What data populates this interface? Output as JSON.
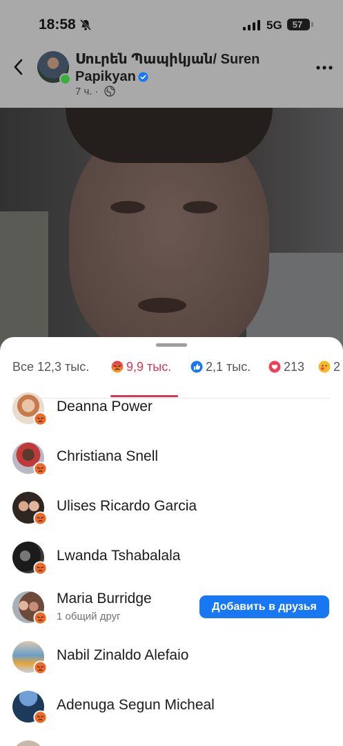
{
  "status_bar": {
    "time": "18:58",
    "network": "5G",
    "battery": "57"
  },
  "post": {
    "author": "Սուրեն Պապիկյան/ Suren Papikyan",
    "time_ago": "7 ч.",
    "separator": "·"
  },
  "reactions": {
    "tabs": [
      {
        "label": "Все 12,3 тыс.",
        "icon": null
      },
      {
        "label": "9,9 тыс.",
        "icon": "angry-icon",
        "active": true
      },
      {
        "label": "2,1 тыс.",
        "icon": "like-icon"
      },
      {
        "label": "213",
        "icon": "love-icon"
      },
      {
        "label": "2",
        "icon": "care-icon"
      }
    ],
    "people": [
      {
        "name": "Deanna Power"
      },
      {
        "name": "Christiana Snell"
      },
      {
        "name": "Ulises Ricardo Garcia"
      },
      {
        "name": "Lwanda Tshabalala"
      },
      {
        "name": "Maria Burridge",
        "subtitle": "1 общий друг",
        "button": "Добавить в друзья"
      },
      {
        "name": "Nabil Zinaldo Alefaio"
      },
      {
        "name": "Adenuga Segun Micheal"
      }
    ]
  },
  "colors": {
    "accent": "#e0334f",
    "primary_button": "#1877f2",
    "like": "#1877f2",
    "love": "#f33e58",
    "angry": "#e9710f"
  }
}
